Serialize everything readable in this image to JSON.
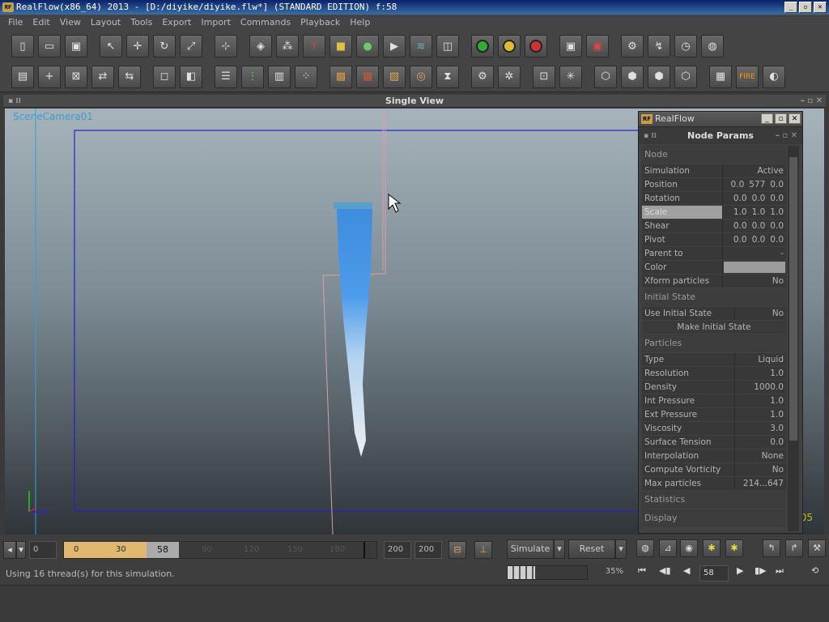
{
  "window": {
    "title": "RealFlow(x86_64) 2013 - [D:/diyike/diyike.flw*] (STANDARD EDITION) f:58",
    "app_icon": "RF"
  },
  "menu": [
    "File",
    "Edit",
    "View",
    "Layout",
    "Tools",
    "Export",
    "Import",
    "Commands",
    "Playback",
    "Help"
  ],
  "viewport": {
    "title": "Single View",
    "camera": "SceneCamera01",
    "frame_number": "05"
  },
  "panel": {
    "window_title": "RealFlow",
    "title": "Node Params",
    "sections": {
      "node": "Node",
      "initial_state": "Initial State",
      "particles": "Particles",
      "statistics": "Statistics",
      "display": "Display"
    },
    "node_rows": [
      {
        "label": "Simulation",
        "values": [
          "Active"
        ]
      },
      {
        "label": "Position",
        "values": [
          "0.0",
          "577",
          "0.0"
        ]
      },
      {
        "label": "Rotation",
        "values": [
          "0.0",
          "0.0",
          "0.0"
        ]
      },
      {
        "label": "Scale",
        "values": [
          "1.0",
          "1.0",
          "1.0"
        ]
      },
      {
        "label": "Shear",
        "values": [
          "0.0",
          "0.0",
          "0.0"
        ]
      },
      {
        "label": "Pivot",
        "values": [
          "0.0",
          "0.0",
          "0.0"
        ]
      },
      {
        "label": "Parent to",
        "values": [
          "-"
        ]
      }
    ],
    "color_label": "Color",
    "color_value": "#9c9c9c",
    "xform": {
      "label": "Xform particles",
      "value": "No"
    },
    "initial_rows": [
      {
        "label": "Use Initial State",
        "value": "No"
      }
    ],
    "make_initial": "Make Initial State",
    "particle_rows": [
      {
        "label": "Type",
        "value": "Liquid"
      },
      {
        "label": "Resolution",
        "value": "1.0"
      },
      {
        "label": "Density",
        "value": "1000.0"
      },
      {
        "label": "Int Pressure",
        "value": "1.0"
      },
      {
        "label": "Ext Pressure",
        "value": "1.0"
      },
      {
        "label": "Viscosity",
        "value": "3.0"
      },
      {
        "label": "Surface Tension",
        "value": "0.0"
      },
      {
        "label": "Interpolation",
        "value": "None"
      },
      {
        "label": "Compute Vorticity",
        "value": "No"
      },
      {
        "label": "Max particles",
        "value": "214...647"
      }
    ]
  },
  "timeline": {
    "start": "0",
    "range_start": "0",
    "ticks": [
      "0",
      "30",
      "60",
      "90",
      "120",
      "150",
      "180"
    ],
    "current": "58",
    "end_a": "200",
    "end_b": "200"
  },
  "controls": {
    "simulate": "Simulate",
    "reset": "Reset",
    "frame": "58",
    "progress_pct": "35%",
    "progress_fraction": 0.35
  },
  "status": "Using 16 thread(s) for this simulation."
}
